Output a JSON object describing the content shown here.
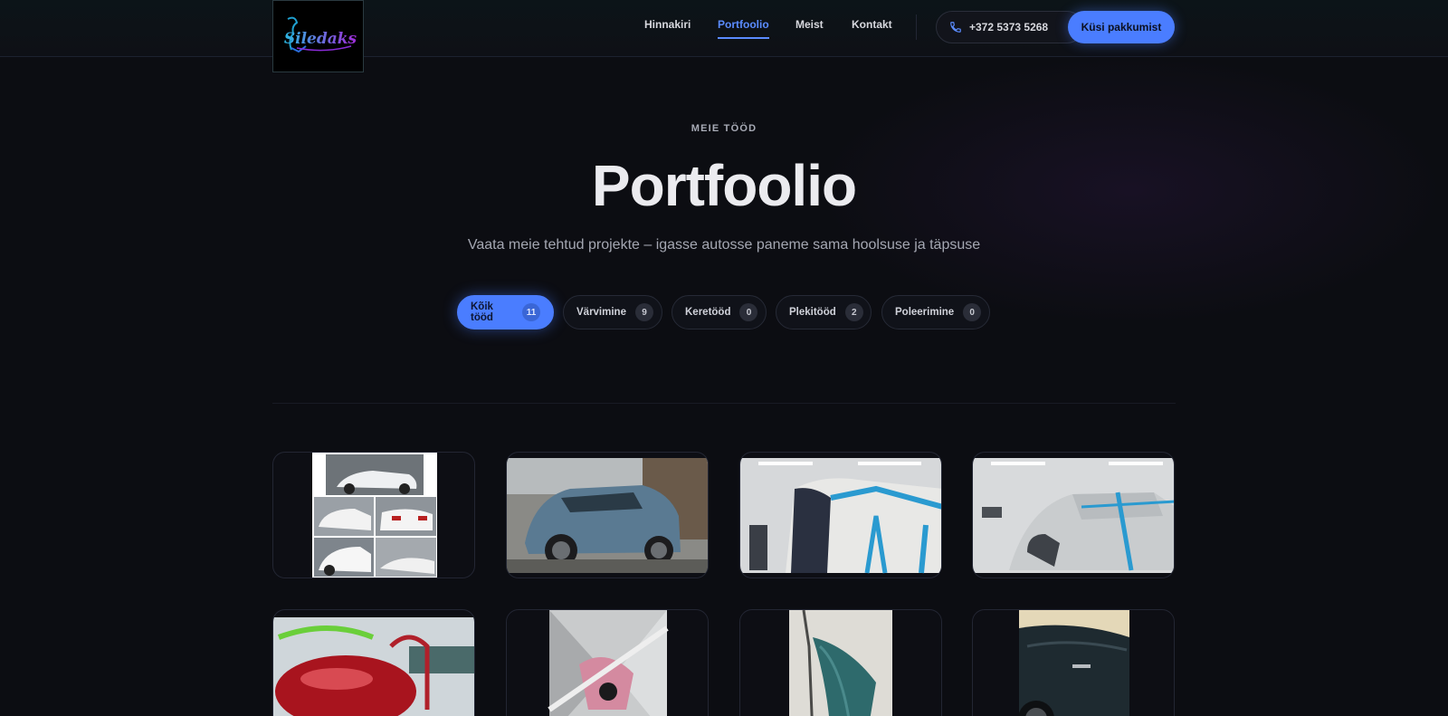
{
  "header": {
    "brand": "Siledaks",
    "nav": [
      {
        "label": "Hinnakiri",
        "active": false
      },
      {
        "label": "Portfoolio",
        "active": true
      },
      {
        "label": "Meist",
        "active": false
      },
      {
        "label": "Kontakt",
        "active": false
      }
    ],
    "phone": "+372 5373 5268",
    "cta_label": "Küsi pakkumist"
  },
  "hero": {
    "eyebrow": "MEIE TÖÖD",
    "title": "Portfoolio",
    "subtitle": "Vaata meie tehtud projekte – igasse autosse paneme sama hoolsuse ja täpsuse"
  },
  "filters": [
    {
      "label": "Kõik tööd",
      "count": "11",
      "active": true
    },
    {
      "label": "Värvimine",
      "count": "9",
      "active": false
    },
    {
      "label": "Keretööd",
      "count": "0",
      "active": false
    },
    {
      "label": "Plekitööd",
      "count": "2",
      "active": false
    },
    {
      "label": "Poleerimine",
      "count": "0",
      "active": false
    }
  ],
  "colors": {
    "accent": "#4a7dff",
    "background": "#0c0d12"
  },
  "icons": {
    "phone": "phone-icon"
  }
}
